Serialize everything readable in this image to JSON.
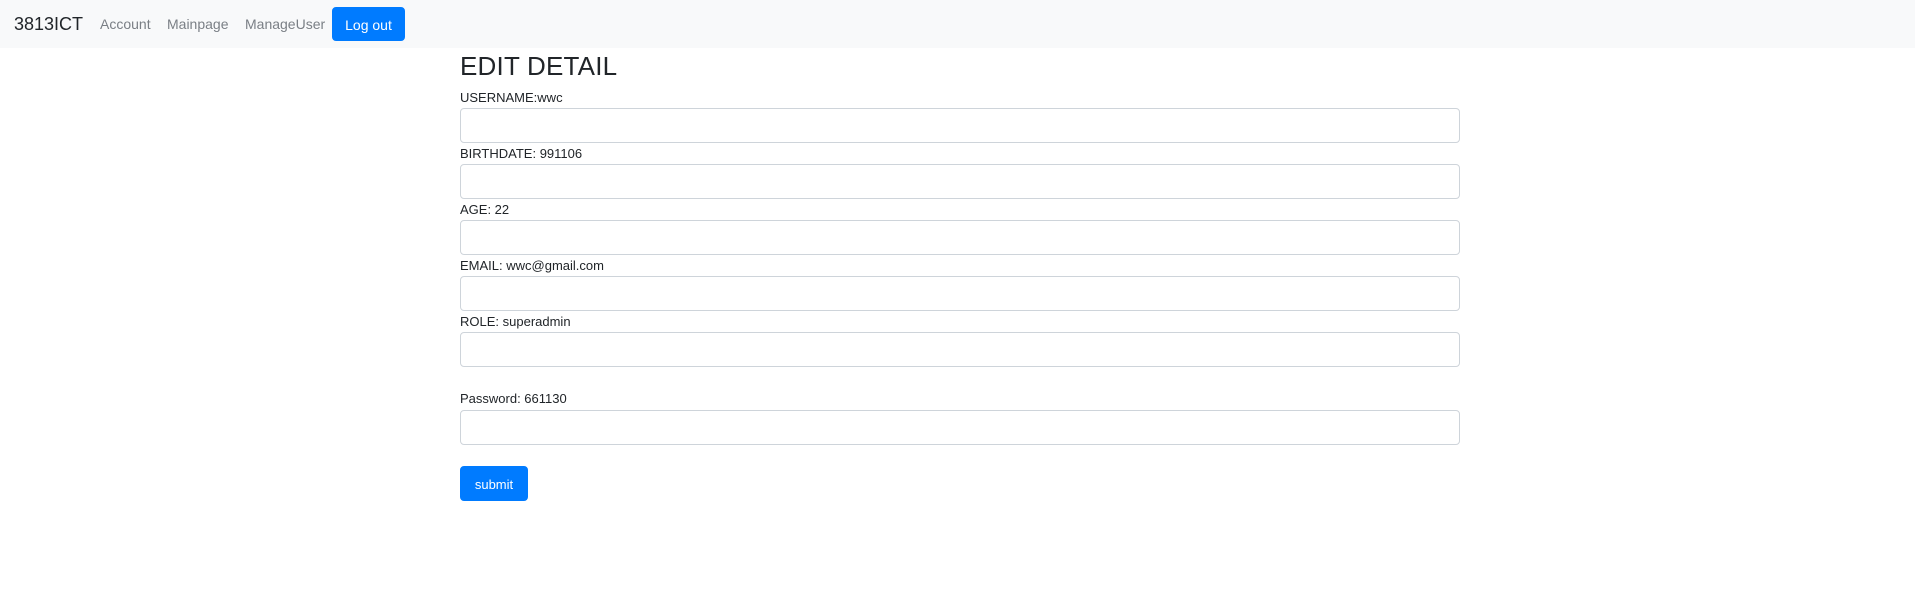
{
  "navbar": {
    "brand": "3813ICT",
    "links": {
      "account": "Account",
      "mainpage": "Mainpage",
      "manageuser": "ManageUser"
    },
    "logout_label": "Log out",
    "background_color": "#f8f9fa",
    "accent_color": "#007bff"
  },
  "form": {
    "title": "EDIT DETAIL",
    "fields": {
      "username": {
        "label": "USERNAME:wwc",
        "value": "",
        "placeholder": ""
      },
      "birthdate": {
        "label": "BIRTHDATE: 991106",
        "value": "",
        "placeholder": ""
      },
      "age": {
        "label": "AGE: 22",
        "value": "",
        "placeholder": ""
      },
      "email": {
        "label": "EMAIL: wwc@gmail.com",
        "value": "",
        "placeholder": ""
      },
      "role": {
        "label": "ROLE: superadmin",
        "value": "",
        "placeholder": ""
      },
      "password": {
        "label": "Password: 661130",
        "value": "",
        "placeholder": ""
      }
    },
    "submit_label": "submit"
  }
}
